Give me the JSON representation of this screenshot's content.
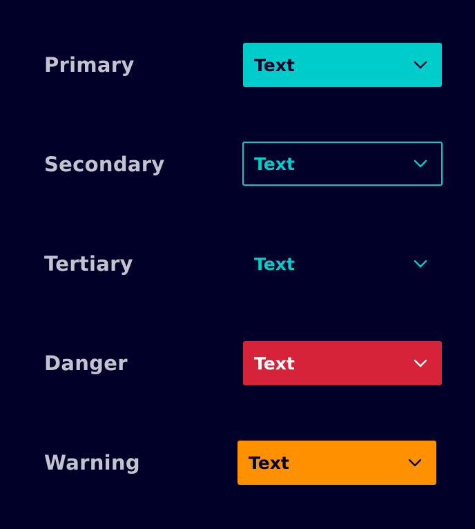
{
  "rows": [
    {
      "label": "Primary",
      "button_text": "Text",
      "icon": "chevron-down-icon"
    },
    {
      "label": "Secondary",
      "button_text": "Text",
      "icon": "chevron-down-icon"
    },
    {
      "label": "Tertiary",
      "button_text": "Text",
      "icon": "chevron-down-icon"
    },
    {
      "label": "Danger",
      "button_text": "Text",
      "icon": "chevron-down-icon"
    },
    {
      "label": "Warning",
      "button_text": "Text",
      "icon": "chevron-down-icon"
    }
  ],
  "colors": {
    "background": "#000028",
    "label": "#c3c3d0",
    "primary": "#00cccc",
    "danger": "#d72339",
    "warning": "#ff9000",
    "dark_text": "#000028",
    "light_text": "#ffffff"
  }
}
